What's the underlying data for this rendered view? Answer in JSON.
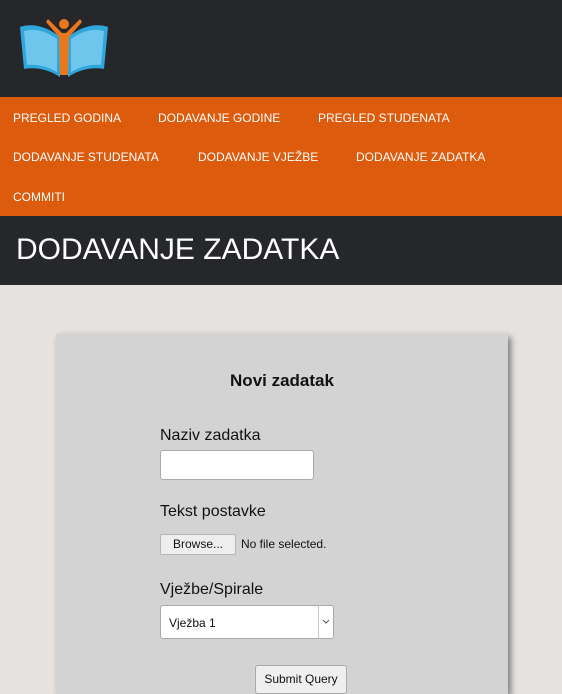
{
  "header": {
    "logo_icon": "book-person-logo-icon"
  },
  "nav": {
    "items": [
      {
        "label": "PREGLED GODINA"
      },
      {
        "label": "DODAVANJE GODINE"
      },
      {
        "label": "PREGLED STUDENATA"
      },
      {
        "label": "DODAVANJE STUDENATA"
      },
      {
        "label": "DODAVANJE VJEŽBE"
      },
      {
        "label": "DODAVANJE ZADATKA"
      },
      {
        "label": "COMMITI"
      }
    ]
  },
  "page": {
    "title": "DODAVANJE ZADATKA"
  },
  "form": {
    "title": "Novi zadatak",
    "task_name_label": "Naziv zadatka",
    "task_name_value": "",
    "statement_label": "Tekst postavke",
    "browse_label": "Browse...",
    "file_status": "No file selected.",
    "exercise_label": "Vježbe/Spirale",
    "exercise_selected": "Vježba 1",
    "submit_label": "Submit Query"
  },
  "colors": {
    "header_bg": "#26272b",
    "nav_bg": "#dc5b0c",
    "page_bg": "#e6e2e0",
    "card_bg": "#d3d3d3",
    "logo_blue": "#2fa7dc",
    "logo_orange": "#e8771e"
  }
}
